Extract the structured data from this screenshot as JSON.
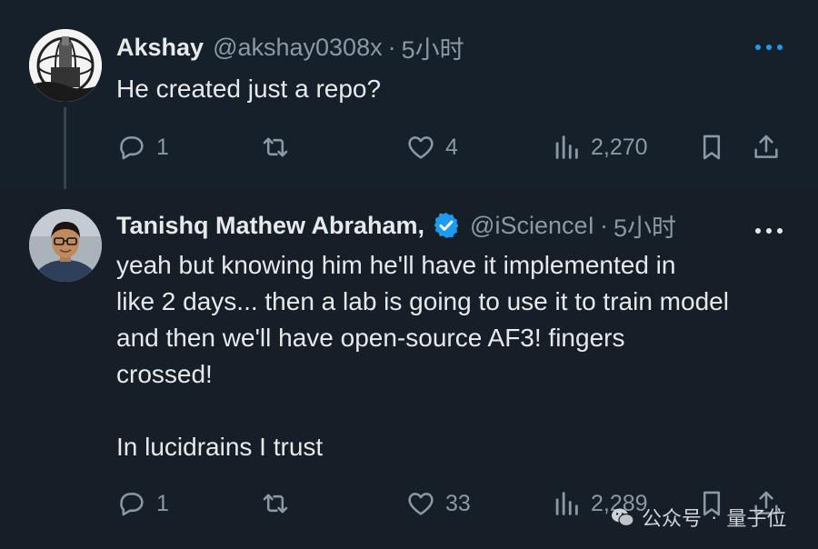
{
  "tweets": [
    {
      "name": "Akshay",
      "handle": "@akshay0308x",
      "dot": "·",
      "time": "5小时",
      "text": "He created just a repo?",
      "replies": "1",
      "retweets": "",
      "likes": "4",
      "views": "2,270"
    },
    {
      "name": "Tanishq Mathew Abraham,",
      "handle": "@iScienceI",
      "dot": "·",
      "time": "5小时",
      "text": "yeah but knowing him he'll have it implemented in\nlike 2 days... then a lab is going to use it to train model\nand then we'll have open-source AF3! fingers\ncrossed!\n\nIn lucidrains I trust",
      "replies": "1",
      "retweets": "",
      "likes": "33",
      "views": "2,289"
    }
  ],
  "watermark": {
    "left": "公众号",
    "sep": "·",
    "right": "量子位"
  },
  "colors": {
    "background": "#15202b",
    "text": "#e7e9ea",
    "secondary": "#8b98a5",
    "verified": "#1d9bf0",
    "more_icon": "#1d9bf0"
  },
  "icons": [
    "more-icon",
    "verified-badge-icon",
    "reply-icon",
    "retweet-icon",
    "like-icon",
    "views-icon",
    "bookmark-icon",
    "share-icon",
    "wechat-icon"
  ]
}
